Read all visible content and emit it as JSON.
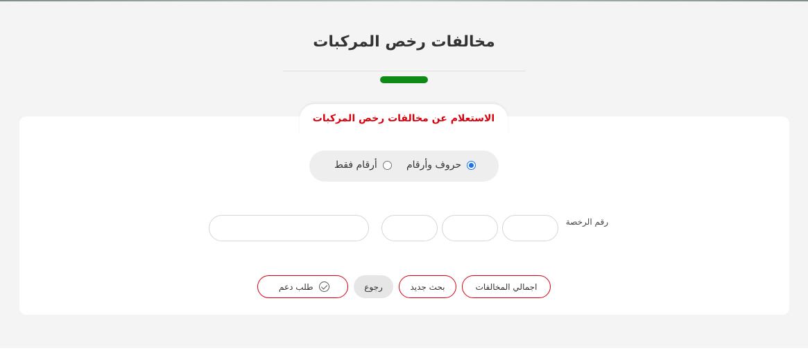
{
  "page": {
    "title": "مخالفات رخص المركبات",
    "accent_color": "#0e8a16"
  },
  "card": {
    "heading": "الاستعلام عن مخالفات رخص المركبات",
    "heading_color": "#d9000d"
  },
  "plate_type": {
    "options": [
      {
        "label": "حروف وأرقام",
        "checked": true
      },
      {
        "label": "أرقام فقط",
        "checked": false
      }
    ]
  },
  "plate_form": {
    "label": "رقم الرخصة",
    "fields": [
      "",
      "",
      "",
      ""
    ]
  },
  "actions": {
    "total_violations": "اجمالي المخالفات",
    "new_search": "بحث جديد",
    "back": "رجوع",
    "support_request": "طلب دعم"
  }
}
